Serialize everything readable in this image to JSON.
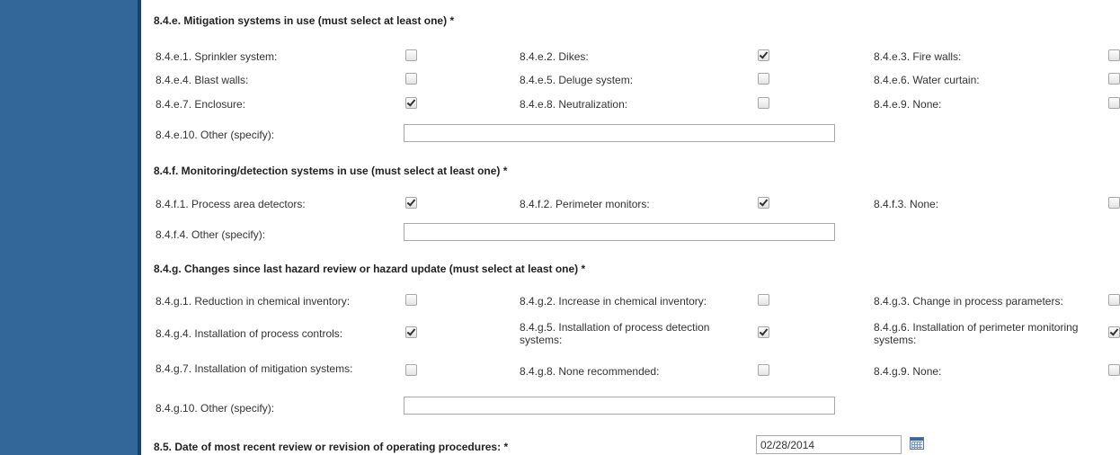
{
  "mitigation": {
    "title": "8.4.e. Mitigation systems in use (must select at least one) *",
    "items": [
      {
        "label": "8.4.e.1. Sprinkler system:",
        "checked": false
      },
      {
        "label": "8.4.e.2. Dikes:",
        "checked": true
      },
      {
        "label": "8.4.e.3. Fire walls:",
        "checked": false
      },
      {
        "label": "8.4.e.4. Blast walls:",
        "checked": false
      },
      {
        "label": "8.4.e.5. Deluge system:",
        "checked": false
      },
      {
        "label": "8.4.e.6. Water curtain:",
        "checked": false
      },
      {
        "label": "8.4.e.7. Enclosure:",
        "checked": true
      },
      {
        "label": "8.4.e.8. Neutralization:",
        "checked": false
      },
      {
        "label": "8.4.e.9. None:",
        "checked": false
      }
    ],
    "other_label": "8.4.e.10. Other (specify):",
    "other_value": ""
  },
  "monitoring": {
    "title": "8.4.f. Monitoring/detection systems in use (must select at least one) *",
    "items": [
      {
        "label": "8.4.f.1. Process area detectors:",
        "checked": true
      },
      {
        "label": "8.4.f.2. Perimeter monitors:",
        "checked": true
      },
      {
        "label": "8.4.f.3. None:",
        "checked": false
      }
    ],
    "other_label": "8.4.f.4. Other (specify):",
    "other_value": ""
  },
  "changes": {
    "title": "8.4.g. Changes since last hazard review or hazard update (must select at least one) *",
    "items": [
      {
        "label": "8.4.g.1. Reduction in chemical inventory:",
        "checked": false
      },
      {
        "label": "8.4.g.2. Increase in chemical inventory:",
        "checked": false
      },
      {
        "label": "8.4.g.3. Change in process parameters:",
        "checked": false
      },
      {
        "label": "8.4.g.4. Installation of process controls:",
        "checked": true
      },
      {
        "label": "8.4.g.5. Installation of process detection systems:",
        "checked": true
      },
      {
        "label": "8.4.g.6. Installation of perimeter monitoring systems:",
        "checked": true
      },
      {
        "label": "8.4.g.7. Installation of mitigation systems:",
        "checked": false
      },
      {
        "label": "8.4.g.8. None recommended:",
        "checked": false
      },
      {
        "label": "8.4.g.9. None:",
        "checked": false
      }
    ],
    "other_label": "8.4.g.10. Other (specify):",
    "other_value": ""
  },
  "review_date": {
    "label": "8.5. Date of most recent review or revision of operating procedures: *",
    "value": "02/28/2014",
    "icon": "calendar-icon"
  },
  "colors": {
    "sidebar": "#336699",
    "sidebar_edge": "#1a3f73"
  }
}
